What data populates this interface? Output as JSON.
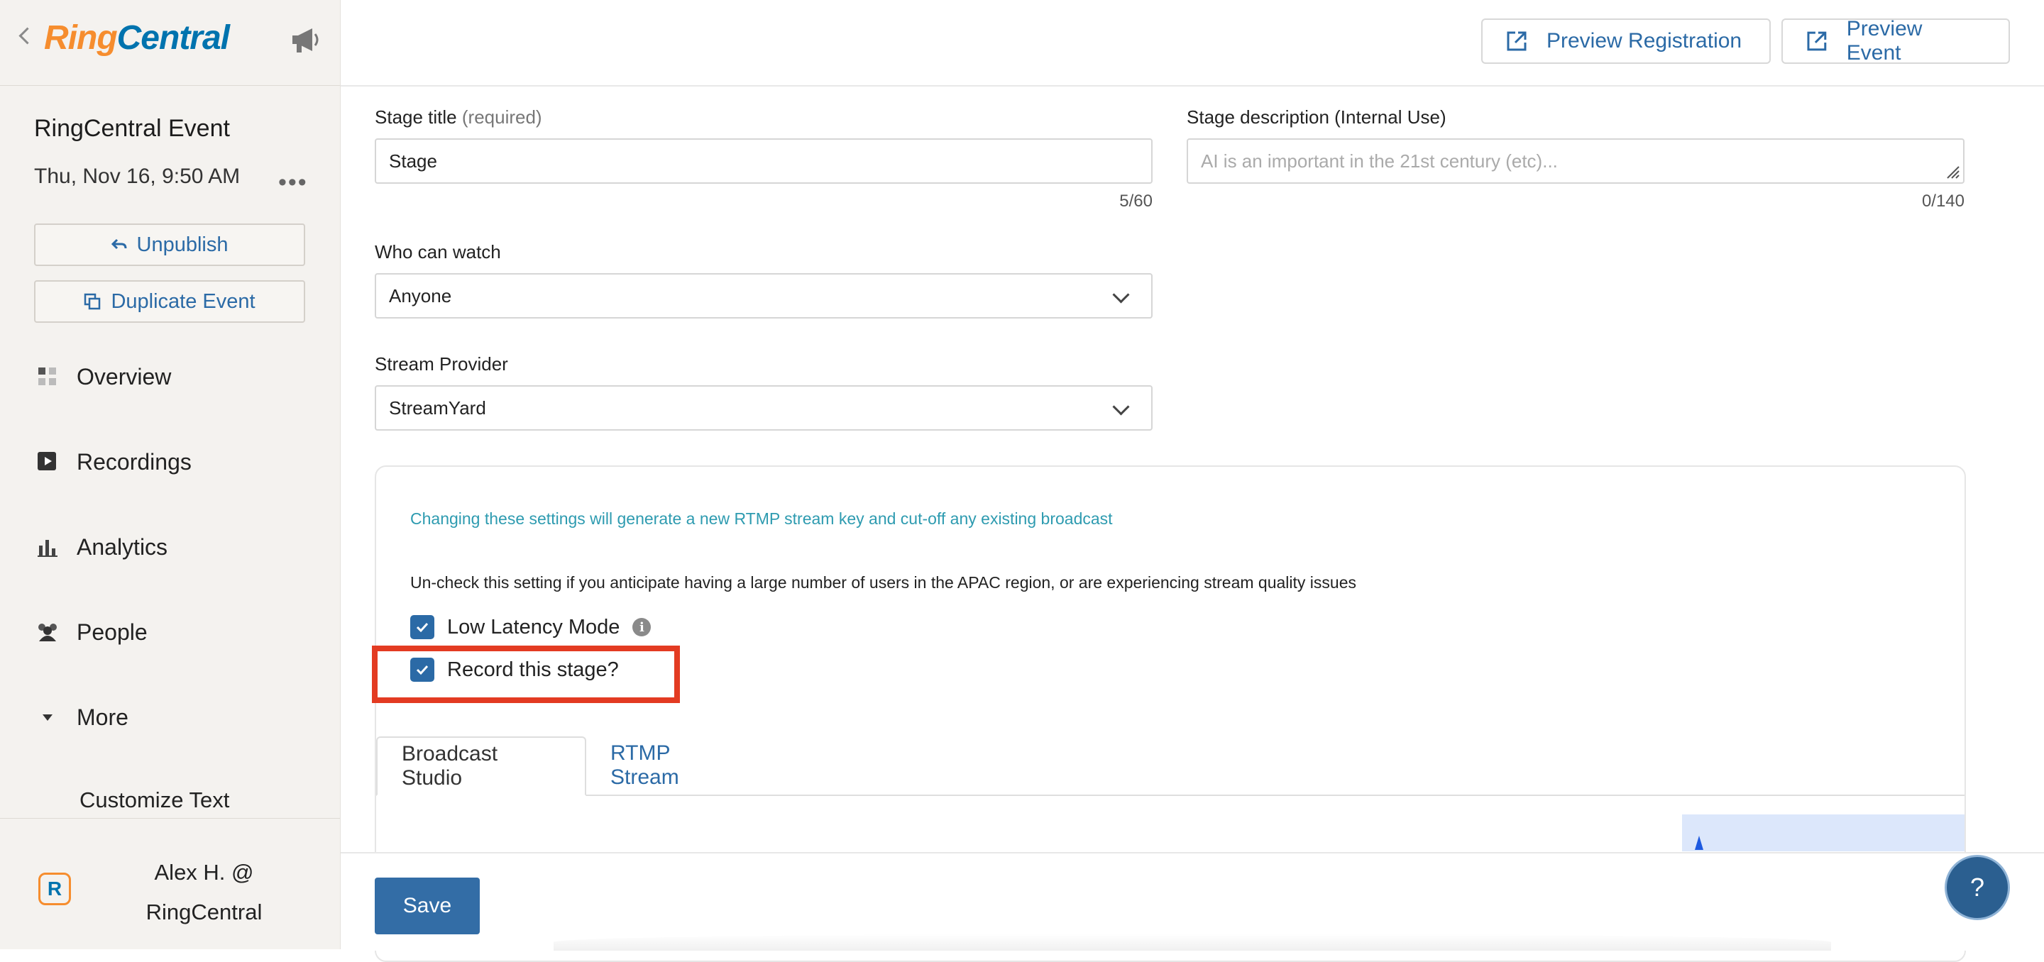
{
  "sidebar": {
    "logo_text_a": "Ring",
    "logo_text_b": "Central",
    "event_title": "RingCentral Event",
    "event_date": "Thu, Nov 16, 9:50 AM",
    "more_dots": "•••",
    "unpublish_label": "Unpublish",
    "duplicate_label": "Duplicate Event",
    "nav": [
      {
        "label": "Overview"
      },
      {
        "label": "Recordings"
      },
      {
        "label": "Analytics"
      },
      {
        "label": "People"
      },
      {
        "label": "More"
      }
    ],
    "sub_item": "Customize Text",
    "user_name_line1": "Alex H. @",
    "user_name_line2": "RingCentral"
  },
  "topbar": {
    "preview_registration": "Preview Registration",
    "preview_event": "Preview Event"
  },
  "form": {
    "stage_title_label": "Stage title",
    "stage_title_required": "(required)",
    "stage_title_value": "Stage",
    "stage_title_counter": "5/60",
    "stage_desc_label": "Stage description (Internal Use)",
    "stage_desc_placeholder": "AI is an important in the 21st century (etc)...",
    "stage_desc_counter": "0/140",
    "who_can_watch_label": "Who can watch",
    "who_can_watch_value": "Anyone",
    "stream_provider_label": "Stream Provider",
    "stream_provider_value": "StreamYard"
  },
  "settings": {
    "warning": "Changing these settings will generate a new RTMP stream key and cut-off any existing broadcast",
    "note": "Un-check this setting if you anticipate having a large number of users in the APAC region, or are experiencing stream quality issues",
    "low_latency_label": "Low Latency Mode",
    "low_latency_checked": true,
    "record_label": "Record this stage?",
    "record_checked": true
  },
  "tabs": [
    {
      "label": "Broadcast Studio",
      "active": true
    },
    {
      "label": "RTMP Stream",
      "active": false
    }
  ],
  "footer": {
    "save_label": "Save",
    "help_label": "?"
  },
  "colors": {
    "accent": "#2b6aa6",
    "highlight": "#e33b22",
    "warning_text": "#2e9bb0",
    "logo_orange": "#f68d2e",
    "logo_blue": "#0073ae"
  }
}
